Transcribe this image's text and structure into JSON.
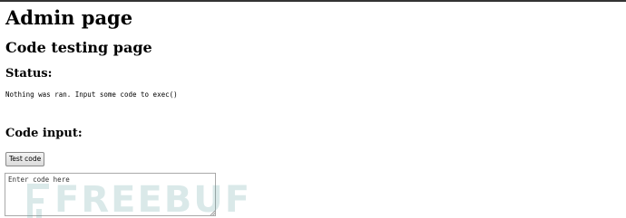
{
  "page": {
    "title": "Admin page",
    "subtitle": "Code testing page"
  },
  "status": {
    "heading": "Status:",
    "message": "Nothing was ran. Input some code to exec()"
  },
  "code_input": {
    "heading": "Code input:",
    "button_label": "Test code",
    "placeholder": "Enter code here"
  },
  "watermark": {
    "text": "FREEBUF",
    "color": "#5a9ea0"
  },
  "colors": {
    "top_border": "#333333",
    "button_border": "#8a8a8a",
    "textarea_border": "#a9a9a9"
  }
}
